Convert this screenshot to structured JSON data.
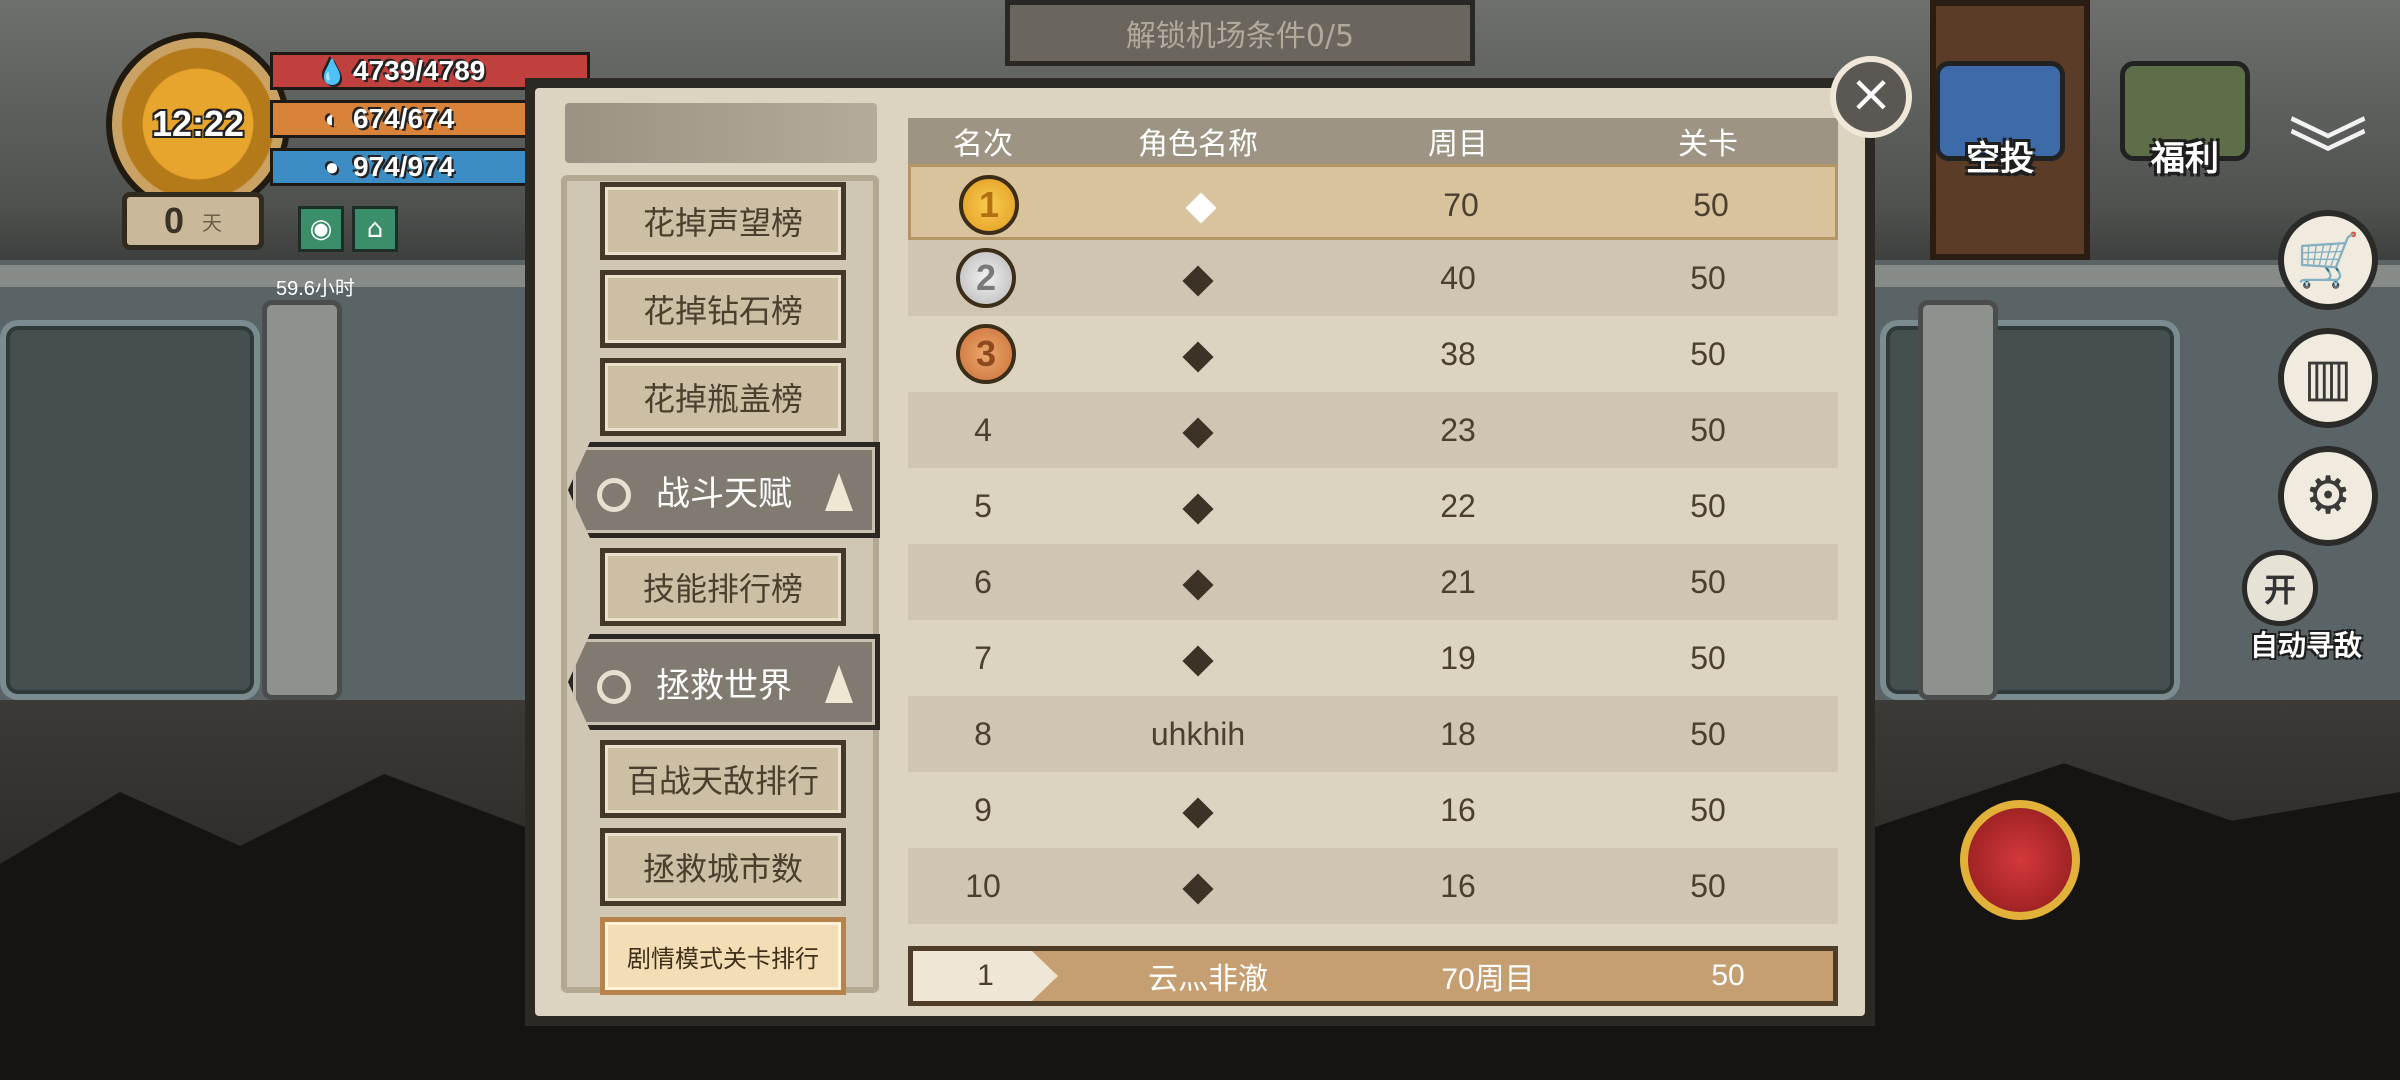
{
  "hud": {
    "time": "12:22",
    "health": "4739/4789",
    "hunger": "674/674",
    "water": "974/974",
    "day_count": "0",
    "day_unit": "天",
    "hours": "59.6小时"
  },
  "top_sign": "解锁机场条件0/5",
  "top_right": {
    "airdrop_label": "空投",
    "welfare_label": "福利"
  },
  "side_controls": {
    "auto_toggle": "开",
    "auto_label": "自动寻敌"
  },
  "leaderboard": {
    "columns": [
      "名次",
      "角色名称",
      "周目",
      "关卡"
    ],
    "nav": [
      {
        "label": "花掉声望榜"
      },
      {
        "label": "花掉钻石榜"
      },
      {
        "label": "花掉瓶盖榜"
      },
      {
        "label": "战斗天赋"
      },
      {
        "label": "技能排行榜"
      },
      {
        "label": "拯救世界"
      },
      {
        "label": "百战天敌排行"
      },
      {
        "label": "拯救城市数"
      },
      {
        "label": "剧情模式关卡排行"
      }
    ],
    "rows": [
      {
        "rank": "1",
        "name": "�",
        "week": "70",
        "stage": "50"
      },
      {
        "rank": "2",
        "name": "�",
        "week": "40",
        "stage": "50"
      },
      {
        "rank": "3",
        "name": "�",
        "week": "38",
        "stage": "50"
      },
      {
        "rank": "4",
        "name": "�",
        "week": "23",
        "stage": "50"
      },
      {
        "rank": "5",
        "name": "�",
        "week": "22",
        "stage": "50"
      },
      {
        "rank": "6",
        "name": "�",
        "week": "21",
        "stage": "50"
      },
      {
        "rank": "7",
        "name": "�",
        "week": "19",
        "stage": "50"
      },
      {
        "rank": "8",
        "name": "uhkhih",
        "week": "18",
        "stage": "50"
      },
      {
        "rank": "9",
        "name": "�",
        "week": "16",
        "stage": "50"
      },
      {
        "rank": "10",
        "name": "�",
        "week": "16",
        "stage": "50"
      }
    ],
    "my_row": {
      "rank": "1",
      "name": "云灬非澈",
      "week": "70周目",
      "stage": "50"
    }
  }
}
